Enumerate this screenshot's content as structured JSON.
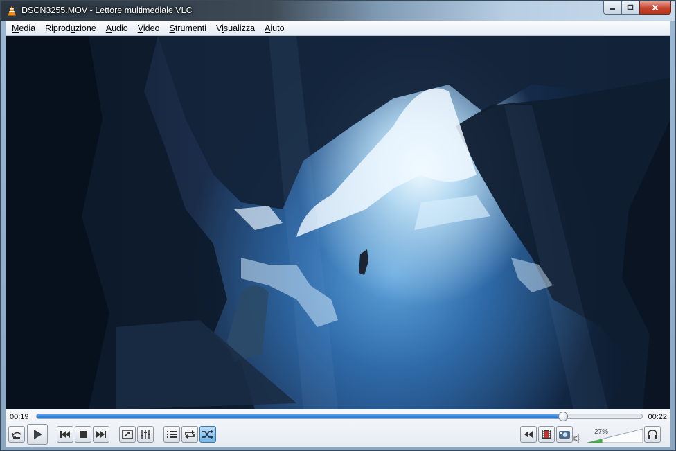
{
  "window": {
    "title": "DSCN3255.MOV - Lettore multimediale VLC",
    "app_icon": "vlc-cone-icon"
  },
  "menu": {
    "items": [
      {
        "label": "Media",
        "ul": 0
      },
      {
        "label": "Riproduzione",
        "ul": 6
      },
      {
        "label": "Audio",
        "ul": 0
      },
      {
        "label": "Video",
        "ul": 0
      },
      {
        "label": "Strumenti",
        "ul": 0
      },
      {
        "label": "Visualizza",
        "ul": 1
      },
      {
        "label": "Aiuto",
        "ul": 0
      }
    ]
  },
  "playback": {
    "elapsed": "00:19",
    "total": "00:22",
    "progress_fraction": 0.87,
    "volume_label": "27%",
    "volume_fraction": 0.27
  },
  "colors": {
    "seek_fill": "#1f6fc9",
    "active_button": "#74b4e4",
    "close_button": "#c5432c"
  }
}
